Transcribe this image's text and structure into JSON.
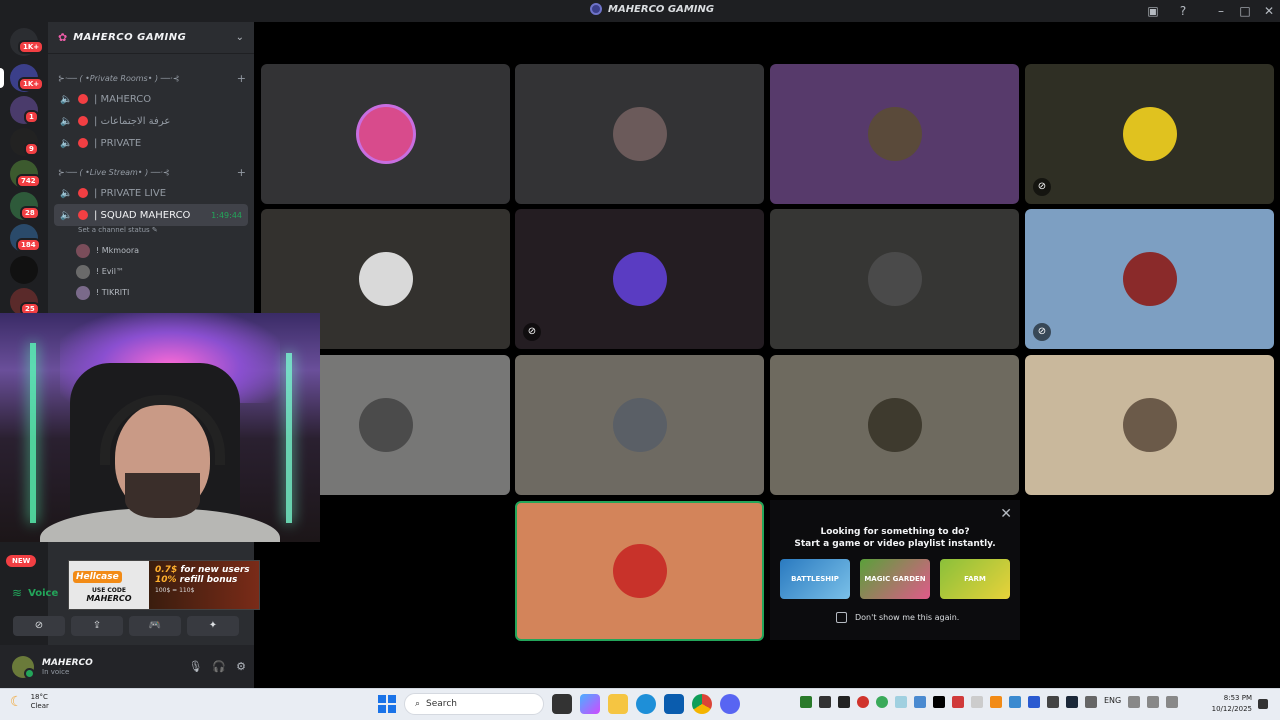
{
  "window": {
    "title": "MAHERCO GAMING"
  },
  "rail": {
    "badges": [
      "1K+",
      "1K+",
      "1",
      "9",
      "742",
      "28",
      "184",
      "25"
    ]
  },
  "guild": {
    "name": "MAHERCO GAMING",
    "categories": [
      {
        "label": "⊱·── ( •Private Rooms• ) ──·⊰",
        "channels": [
          "| MAHERCO",
          "| عرفة الاجتماعات",
          "| PRIVATE"
        ]
      },
      {
        "label": "⊱·── ( •Live Stream• ) ──·⊰",
        "channels": [
          "| PRIVATE LIVE",
          "| SQUAD MAHERCO"
        ]
      }
    ],
    "active_channel": {
      "name": "| SQUAD MAHERCO",
      "time": "1:49:44",
      "status_hint": "Set a channel status"
    },
    "voice_users": [
      "! Mkmoora",
      "! Evil™",
      "! TIKRITI"
    ]
  },
  "badge_new": "NEW",
  "voice": {
    "label": "Voice"
  },
  "ad": {
    "brand": "Hellcase",
    "use_code": "USE CODE",
    "code": "MAHERCO",
    "line1_accent": "0.7$",
    "line1": " for new users",
    "line2_accent": "10%",
    "line2": " refill bonus",
    "small": "100$ = 110$"
  },
  "user": {
    "name": "MAHERCO",
    "status": "In voice"
  },
  "tiles": {
    "colors": [
      "#333335",
      "#333335",
      "#573a6b",
      "#2f2f24",
      "#33312e",
      "#241d22",
      "#363634",
      "#7d9fc2",
      "#777776",
      "#6e6a62",
      "#6e6a5f",
      "#c9b89c",
      "#d3845a"
    ],
    "avatar_colors": [
      "#d84b8c",
      "#6b5a5a",
      "#5a4a3a",
      "#e0c21f",
      "#d9d9d9",
      "#5a3cc2",
      "#4a4a4a",
      "#8a2a2a",
      "#4b4b4b",
      "#5a5f66",
      "#3e3a2e",
      "#6b5a49",
      "#c8322a"
    ],
    "muted": [
      false,
      false,
      false,
      true,
      false,
      true,
      false,
      true,
      false,
      false,
      false,
      false,
      false
    ]
  },
  "activity": {
    "heading": "Looking for something to do?",
    "subheading": "Start a game or video playlist instantly.",
    "games": [
      "BATTLESHIP",
      "MAGIC GARDEN",
      "FARM"
    ],
    "checkbox": "Don't show me this again."
  },
  "taskbar": {
    "temp": "18°C",
    "weather": "Clear",
    "search_placeholder": "Search",
    "lang": "ENG",
    "time": "8:53 PM",
    "date": "10/12/2025"
  },
  "icons": {
    "mute": "mic-off-icon",
    "close": "close-icon"
  }
}
